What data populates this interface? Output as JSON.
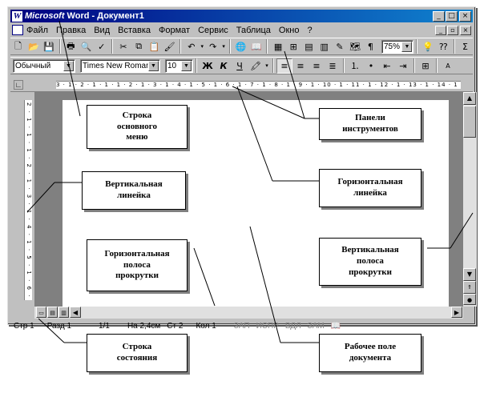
{
  "window": {
    "title_brand": "Microsoft",
    "title_rest": " Word - Документ1",
    "app_icon": "word-icon",
    "controls": [
      "_",
      "□",
      "×"
    ]
  },
  "menu": {
    "items": [
      "Файл",
      "Правка",
      "Вид",
      "Вставка",
      "Формат",
      "Сервис",
      "Таблица",
      "Окно",
      "?"
    ],
    "doc_controls": [
      "_",
      "▫",
      "×"
    ]
  },
  "standard_toolbar": {
    "zoom": "75%"
  },
  "format_toolbar": {
    "style": "Обычный",
    "font": "Times New Roman C",
    "size": "10",
    "bold": "Ж",
    "italic": "К",
    "underline": "Ч"
  },
  "ruler": {
    "horizontal_ticks": "3 · 1 · 2 · 1 · 1 · 1 · 2 · 1 · 3 · 1 · 4 · 1 · 5 · 1 · 6 · 1 · 7 · 1 · 8 · 1 · 9 · 1 · 10 · 1 · 11 · 1 · 12 · 1 · 13 · 1 · 14 · 1 · 15 · 1 · 16 · 1 · 17",
    "vertical_ticks": "2 · 1 · 1 · 1 · 2 · 1 · 3 · 1 · 4 · 1 · 5 · 1 · 6 · 1 · 7 · 1 · 8"
  },
  "status": {
    "page": "Стр  1",
    "section": "Разд  1",
    "pages": "1/1",
    "at": "На  2,4см",
    "line": "Ст  2",
    "col": "Кол  1",
    "indicators": [
      "ЗАП",
      "ИСПР",
      "ВДЛ",
      "ЗАМ"
    ]
  },
  "callouts": {
    "menu_line": "Строка\nосновного\nменю",
    "toolbars": "Панели\nинструментов",
    "vertical_ruler": "Вертикальная\nлинейка",
    "horizontal_ruler": "Горизонтальная\nлинейка",
    "horizontal_scroll": "Горизонтальная\nполоса\nпрокрутки",
    "vertical_scroll": "Вертикальная\nполоса\nпрокрутки",
    "status_line": "Строка\nсостояния",
    "document_area": "Рабочее поле\nдокумента"
  }
}
